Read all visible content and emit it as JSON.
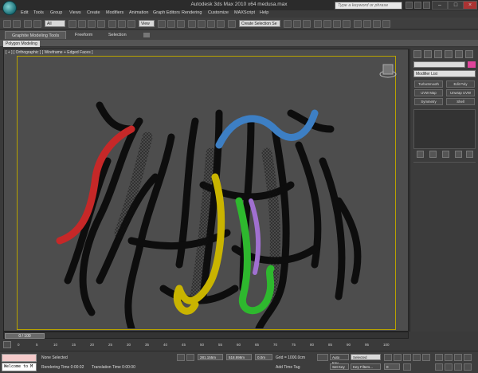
{
  "titlebar": {
    "title": "Autodesk 3ds Max  2010 x64     medusa.max",
    "search_placeholder": "Type a keyword or phrase"
  },
  "menu": [
    "Edit",
    "Tools",
    "Group",
    "Views",
    "Create",
    "Modifiers",
    "Animation",
    "Graph Editors",
    "Rendering",
    "Customize",
    "MAXScript",
    "Help"
  ],
  "toolbar": {
    "selection_filter": "All",
    "view": "View",
    "named_selection": "Create Selection Se"
  },
  "ribbon": {
    "tabs": [
      "Graphite Modeling Tools",
      "Freeform",
      "Selection"
    ],
    "sub_panel": "Polygon Modeling"
  },
  "viewport": {
    "label": "[ + ] [ Orthographic ] [ Wireframe + Edged Faces ]"
  },
  "command_panel": {
    "modifier_list": "Modifier List",
    "modifier_buttons": [
      "TurboSmooth",
      "Edit Poly",
      "UVW Map",
      "Unwrap UVW",
      "Symmetry",
      "Shell"
    ],
    "object_color": "#e0449b"
  },
  "timeline": {
    "frame": "0 / 100",
    "ticks": [
      "0",
      "5",
      "10",
      "15",
      "20",
      "25",
      "30",
      "35",
      "40",
      "45",
      "50",
      "55",
      "60",
      "65",
      "70",
      "75",
      "80",
      "85",
      "90",
      "95",
      "100"
    ]
  },
  "status": {
    "maxscript_output": "Welcome to M",
    "selection": "None Selected",
    "render_time": "Rendering Time  0:00:02",
    "translation_time": "Translation Time  0:00:00",
    "x": "281.155m",
    "y": "518.898m",
    "z": "0.0m",
    "grid": "Grid = 1000.0cm",
    "add_time_tag": "Add Time Tag",
    "auto_key": "Auto Key",
    "set_key": "Set Key",
    "selected": "Selected",
    "key_filters": "Key Filters..."
  }
}
